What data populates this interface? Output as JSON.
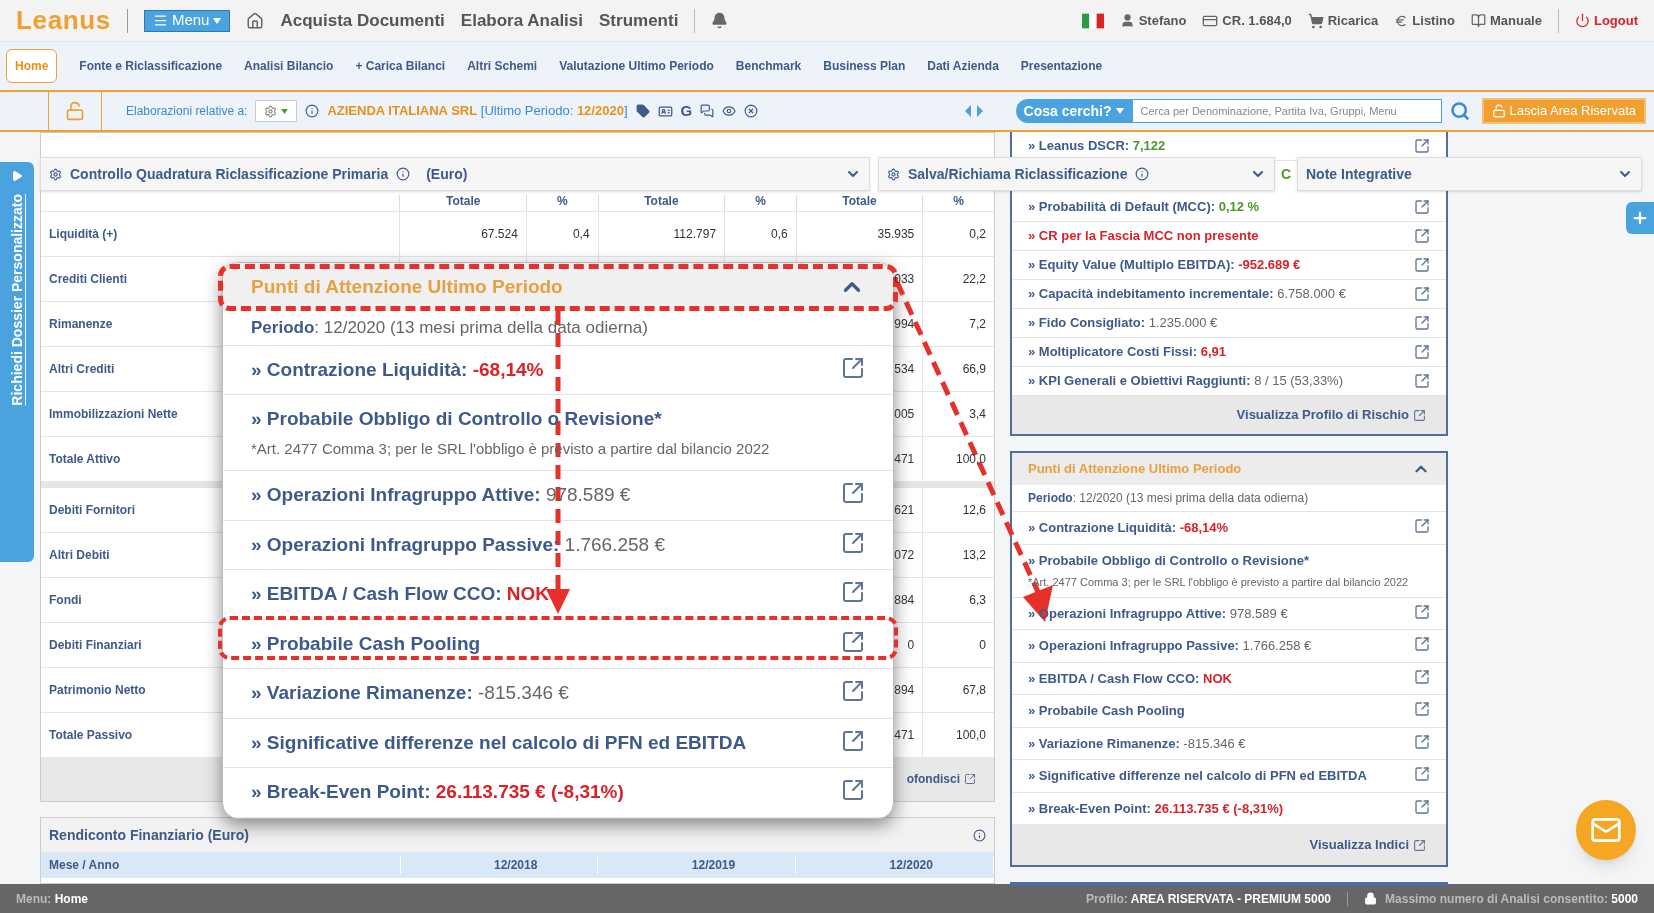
{
  "top_bar": {
    "logo": "Leanus",
    "menu_button": "Menu",
    "nav": [
      "Acquista Documenti",
      "Elabora Analisi",
      "Strumenti"
    ],
    "user": "Stefano",
    "credits": "CR. 1.684,0",
    "recharge": "Ricarica",
    "price_list": "Listino",
    "manual": "Manuale",
    "logout": "Logout"
  },
  "tabs": [
    {
      "label": "Home",
      "selected": true
    },
    {
      "label": "Fonte e Riclassificazione",
      "selected": false
    },
    {
      "label": "Analisi Bilancio",
      "selected": false
    },
    {
      "label": "+ Carica Bilanci",
      "selected": false
    },
    {
      "label": "Altri Schemi",
      "selected": false
    },
    {
      "label": "Valutazione Ultimo Periodo",
      "selected": false
    },
    {
      "label": "Benchmark",
      "selected": false
    },
    {
      "label": "Business Plan",
      "selected": false
    },
    {
      "label": "Dati Azienda",
      "selected": false
    },
    {
      "label": "Presentazione",
      "selected": false
    }
  ],
  "context_bar": {
    "label": "Elaborazioni relative a:",
    "company": "AZIENDA ITALIANA SRL",
    "period_open": "[Ultimo Periodo:",
    "period": "12/2020",
    "period_close": "]",
    "google_glyph": "G",
    "search_button": "Cosa cerchi?",
    "search_placeholder": "Cerca per Denominazione, Partita Iva, Gruppi, Menu",
    "leave_button": "Lascia Area Riservata"
  },
  "dropdown_bars": [
    {
      "title": "Controllo Quadratura Riclassificazione Primaria",
      "suffix": "(Euro)",
      "gear": true
    },
    {
      "title": "Salva/Richiama Riclassificazione",
      "gear": true
    },
    {
      "title": "Note Integrative",
      "gear": false
    }
  ],
  "peek_letter": "C",
  "vertical_tab": "Richiedi Dossier Personalizzato",
  "table": {
    "columns": [
      "Totale",
      "%",
      "Totale",
      "%",
      "Totale",
      "%"
    ],
    "groups": [
      [
        {
          "label": "Liquidità (+)",
          "values": [
            "67.524",
            "0,4",
            "112.797",
            "0,6",
            "35.935",
            "0,2"
          ]
        },
        {
          "label": "Crediti Clienti",
          "values": [
            "033",
            "22,2"
          ]
        },
        {
          "label": "Rimanenze",
          "values": [
            "994",
            "7,2"
          ]
        },
        {
          "label": "Altri Crediti",
          "values": [
            "534",
            "66,9"
          ]
        },
        {
          "label": "Immobilizzazioni Nette",
          "values": [
            "005",
            "3,4"
          ]
        },
        {
          "label": "Totale Attivo",
          "values": [
            "471",
            "100,0"
          ]
        }
      ],
      [
        {
          "label": "Debiti Fornitori",
          "values": [
            "621",
            "12,6"
          ]
        },
        {
          "label": "Altri Debiti",
          "values": [
            "072",
            "13,2"
          ]
        },
        {
          "label": "Fondi",
          "values": [
            "884",
            "6,3"
          ]
        },
        {
          "label": "Debiti Finanziari",
          "values": [
            "0",
            "0"
          ]
        },
        {
          "label": "Patrimonio Netto",
          "values": [
            "894",
            "67,8"
          ]
        },
        {
          "label": "Totale Passivo",
          "values": [
            "471",
            "100,0"
          ]
        }
      ]
    ],
    "footer_link": "ofondisci"
  },
  "financial_card": {
    "title": "Rendiconto Finanziario (Euro)",
    "columns": [
      "Mese / Anno",
      "12/2018",
      "12/2019",
      "12/2020"
    ]
  },
  "popup": {
    "title": "Punti di Attenzione Ultimo Periodo",
    "expanded": true,
    "period_label": "Periodo",
    "period_value": ": 12/2020 (13 mesi prima della data odierna)",
    "items": [
      {
        "label": "» Contrazione Liquidità:",
        "value": "-68,14%",
        "kind": "alert"
      },
      {
        "label": "» Probabile Obbligo di Controllo o Revisione*",
        "note": "*Art. 2477 Comma 3; per le SRL l'obbligo è previsto a partire dal bilancio 2022",
        "kind": "plain"
      },
      {
        "label": "» Operazioni Infragruppo Attive:",
        "value": "978.589 €",
        "kind": "plain"
      },
      {
        "label": "» Operazioni Infragruppo Passive:",
        "value": "1.766.258 €",
        "kind": "plain"
      },
      {
        "label": "» EBITDA / Cash Flow CCO:",
        "value": "NOK",
        "kind": "alert"
      },
      {
        "label": "» Probabile Cash Pooling",
        "kind": "plain"
      },
      {
        "label": "» Variazione Rimanenze:",
        "value": "-815.346 €",
        "kind": "plain"
      },
      {
        "label": "» Significative differenze nel calcolo di PFN ed EBITDA",
        "kind": "plain"
      },
      {
        "label": "» Break-Even Point:",
        "value": "26.113.735 € (-8,31%)",
        "kind": "alert"
      }
    ]
  },
  "risk_card": {
    "items": [
      {
        "label": "» Leanus DSCR:",
        "value": "7,122",
        "kind": "good"
      },
      {
        "label": "» Probabilità di Default (MCC):",
        "value": "0,12 %",
        "kind": "good"
      },
      {
        "label": "» CR per la Fascia MCC non presente",
        "kind": "alert"
      },
      {
        "label": "» Equity Value (Multiplo EBITDA):",
        "value": "-952.689 €",
        "kind": "alert"
      },
      {
        "label": "» Capacità indebitamento incrementale:",
        "value": "6.758.000 €",
        "kind": "plain"
      },
      {
        "label": "» Fido Consigliato:",
        "value": "1.235.000 €",
        "kind": "plain"
      },
      {
        "label": "» Moltiplicatore Costi Fissi:",
        "value": "6,91",
        "kind": "alert"
      },
      {
        "label": "» KPI Generali e Obiettivi Raggiunti:",
        "value": "8 / 15 (53,33%)",
        "kind": "plain"
      }
    ],
    "footer": "Visualizza Profilo di Rischio"
  },
  "attention_card": {
    "title": "Punti di Attenzione Ultimo Periodo",
    "expanded": true,
    "period_label": "Periodo",
    "period_value": ": 12/2020 (13 mesi prima della data odierna)",
    "items": [
      {
        "label": "» Contrazione Liquidità:",
        "value": "-68,14%",
        "kind": "alert"
      },
      {
        "label": "» Probabile Obbligo di Controllo o Revisione*",
        "note": "*Art. 2477 Comma 3; per le SRL l'obbligo è previsto a partire dal bilancio 2022",
        "kind": "plain"
      },
      {
        "label": "» Operazioni Infragruppo Attive:",
        "value": "978.589 €",
        "kind": "plain"
      },
      {
        "label": "» Operazioni Infragruppo Passive:",
        "value": "1.766.258 €",
        "kind": "plain"
      },
      {
        "label": "» EBITDA / Cash Flow CCO:",
        "value": "NOK",
        "kind": "alert"
      },
      {
        "label": "» Probabile Cash Pooling",
        "kind": "plain"
      },
      {
        "label": "» Variazione Rimanenze:",
        "value": "-815.346 €",
        "kind": "plain"
      },
      {
        "label": "» Significative differenze nel calcolo di PFN ed EBITDA",
        "kind": "plain"
      },
      {
        "label": "» Break-Even Point:",
        "value": "26.113.735 € (-8,31%)",
        "kind": "alert"
      }
    ],
    "footer": "Visualizza Indici"
  },
  "status_bar": {
    "menu_label": "Menu:",
    "menu_value": "Home",
    "profile_label": "Profilo:",
    "profile_value": "AREA RISERVATA - PREMIUM 5000",
    "max_label": "Massimo numero di Analisi consentito:",
    "max_value": "5000"
  }
}
